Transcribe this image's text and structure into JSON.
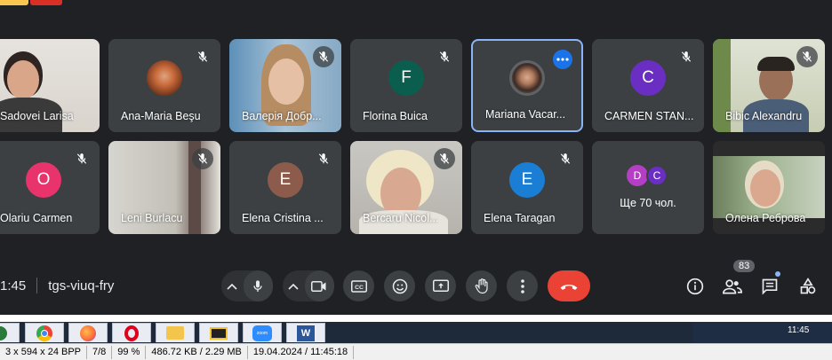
{
  "colors": {
    "background": "#202124",
    "tile": "#3c4043",
    "end_call": "#ea4335",
    "active_border": "#8ab4f8"
  },
  "participants": [
    {
      "name": "Sadovei Larisa",
      "type": "video"
    },
    {
      "name": "Ana-Maria Beşu",
      "type": "photo",
      "muted": true
    },
    {
      "name": "Валерія Добр...",
      "type": "video",
      "muted": true
    },
    {
      "name": "Florina Buica",
      "type": "initial",
      "initial": "F",
      "color": "#0b5e4e",
      "muted": true
    },
    {
      "name": "Mariana Vacar...",
      "type": "photo",
      "active": true
    },
    {
      "name": "CARMEN STAN...",
      "type": "initial",
      "initial": "C",
      "color": "#6a2fc2",
      "muted": true
    },
    {
      "name": "Bibic Alexandru",
      "type": "video",
      "muted": true
    },
    {
      "name": "Olariu Carmen",
      "type": "initial",
      "initial": "O",
      "color": "#e8336d",
      "muted": true
    },
    {
      "name": "Leni Burlacu",
      "type": "video",
      "muted": true
    },
    {
      "name": "Elena Cristina ...",
      "type": "initial",
      "initial": "E",
      "color": "#8d5b4c",
      "muted": true
    },
    {
      "name": "Bercaru Nicol...",
      "type": "video",
      "muted": true
    },
    {
      "name": "Elena Taragan",
      "type": "initial",
      "initial": "E",
      "color": "#1a7fd4",
      "muted": true
    },
    {
      "name": "Ще 70 чол.",
      "type": "others",
      "initials": [
        "D",
        "C"
      ]
    },
    {
      "name": "Олена Реброва",
      "type": "video"
    }
  ],
  "meeting": {
    "time": "1:45",
    "code": "tgs-viuq-fry"
  },
  "controls": {
    "icons": [
      "caret-up-icon",
      "microphone-icon",
      "caret-up-icon",
      "camera-icon",
      "captions-icon",
      "emoji-icon",
      "present-icon",
      "raise-hand-icon",
      "more-options-icon",
      "end-call-icon"
    ],
    "right_icons": [
      "info-icon",
      "people-icon",
      "chat-icon",
      "activities-icon"
    ],
    "people_count": "83"
  },
  "taskbar": {
    "clock": "11:45"
  },
  "statusbar": {
    "dimensions": "3 x 594 x 24 BPP",
    "page": "7/8",
    "zoom": "99 %",
    "size": "486.72 KB / 2.29 MB",
    "datetime": "19.04.2024 / 11:45:18"
  }
}
